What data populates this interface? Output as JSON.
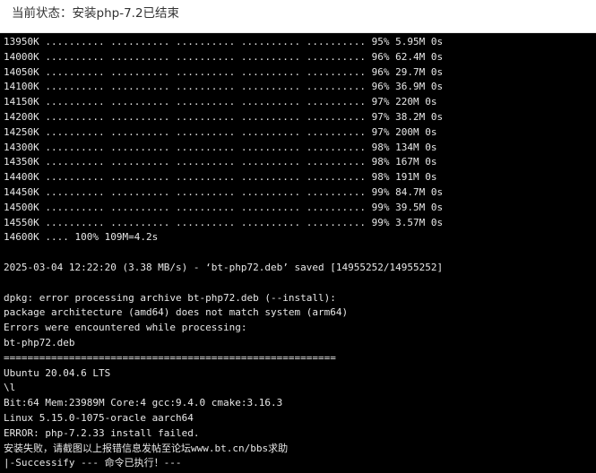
{
  "status": {
    "text": "当前状态：安装php-7.2已结束"
  },
  "console": {
    "lines": [
      "13950K .......... .......... .......... .......... .......... 95% 5.95M 0s",
      "14000K .......... .......... .......... .......... .......... 96% 62.4M 0s",
      "14050K .......... .......... .......... .......... .......... 96% 29.7M 0s",
      "14100K .......... .......... .......... .......... .......... 96% 36.9M 0s",
      "14150K .......... .......... .......... .......... .......... 97% 220M 0s",
      "14200K .......... .......... .......... .......... .......... 97% 38.2M 0s",
      "14250K .......... .......... .......... .......... .......... 97% 200M 0s",
      "14300K .......... .......... .......... .......... .......... 98% 134M 0s",
      "14350K .......... .......... .......... .......... .......... 98% 167M 0s",
      "14400K .......... .......... .......... .......... .......... 98% 191M 0s",
      "14450K .......... .......... .......... .......... .......... 99% 84.7M 0s",
      "14500K .......... .......... .......... .......... .......... 99% 39.5M 0s",
      "14550K .......... .......... .......... .......... .......... 99% 3.57M 0s",
      "14600K .... 100% 109M=4.2s",
      "",
      "2025-03-04 12:22:20 (3.38 MB/s) - ‘bt-php72.deb’ saved [14955252/14955252]",
      "",
      "dpkg: error processing archive bt-php72.deb (--install):",
      "package architecture (amd64) does not match system (arm64)",
      "Errors were encountered while processing:",
      "bt-php72.deb",
      "========================================================",
      "Ubuntu 20.04.6 LTS",
      "\\l",
      "Bit:64 Mem:23989M Core:4 gcc:9.4.0 cmake:3.16.3",
      "Linux 5.15.0-1075-oracle aarch64",
      "ERROR: php-7.2.33 install failed.",
      "安装失败，请截图以上报错信息发帖至论坛www.bt.cn/bbs求助",
      "|-Successify --- 命令已执行！---"
    ]
  }
}
